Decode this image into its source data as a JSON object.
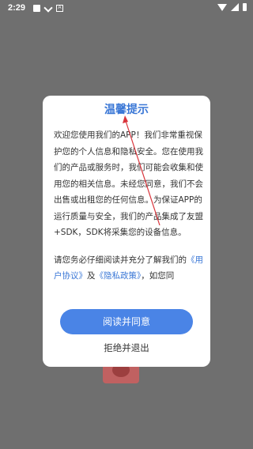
{
  "status_bar": {
    "time": "2:29",
    "left_icons": [
      "image-icon",
      "download-icon",
      "a-icon"
    ],
    "right_icons": [
      "wifi-icon",
      "signal-icon",
      "battery-icon"
    ]
  },
  "dialog": {
    "title": "温馨提示",
    "paragraph1": "欢迎您使用我们的APP！我们非常重视保护您的个人信息和隐私安全。您在使用我们的产品或服务时，我们可能会收集和使用您的相关信息。未经您同意，我们不会出售或出租您的任何信息。为保证APP的运行质量与安全，我们的产品集成了友盟+SDK，SDK将采集您的设备信息。",
    "paragraph2_prefix": "请您务必仔细阅读并充分了解我们的",
    "user_agreement_link": "《用户协议》",
    "and_text": "及",
    "privacy_policy_link": "《隐私政策》",
    "paragraph2_suffix": "，如您同",
    "agree_button": "阅读并同意",
    "reject_button": "拒绝并退出"
  },
  "colors": {
    "overlay": "#6f6f6f",
    "accent": "#3a77d6",
    "button": "#4a84e6",
    "annotation_arrow": "#d9343b"
  }
}
